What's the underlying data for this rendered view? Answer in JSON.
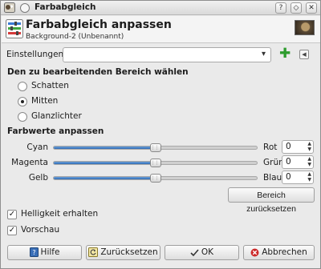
{
  "titlebar": {
    "title": "Farbabgleich"
  },
  "header": {
    "title": "Farbabgleich anpassen",
    "subtitle": "Background-2 (Unbenannt)"
  },
  "settings": {
    "label": "Einstellungen:",
    "value": ""
  },
  "range_section": {
    "title": "Den zu bearbeitenden Bereich wählen",
    "options": [
      {
        "label": "Schatten",
        "selected": false
      },
      {
        "label": "Mitten",
        "selected": true
      },
      {
        "label": "Glanzlichter",
        "selected": false
      }
    ]
  },
  "color_section": {
    "title": "Farbwerte anpassen",
    "sliders": [
      {
        "left": "Cyan",
        "right": "Rot",
        "value": "0",
        "level": 0
      },
      {
        "left": "Magenta",
        "right": "Grün",
        "value": "0",
        "level": 0
      },
      {
        "left": "Gelb",
        "right": "Blau",
        "value": "0",
        "level": 0
      }
    ],
    "reset_range_label": "Bereich zurücksetzen"
  },
  "checkboxes": {
    "preserve_luminosity": {
      "label": "Helligkeit erhalten",
      "checked": true
    },
    "preview": {
      "label": "Vorschau",
      "checked": true
    }
  },
  "buttons": {
    "help": "Hilfe",
    "reset": "Zurücksetzen",
    "ok": "OK",
    "cancel": "Abbrechen"
  },
  "colors": {
    "accent": "#2f6cb5",
    "add": "#2e9c2e",
    "cancel": "#cc2a2a"
  }
}
